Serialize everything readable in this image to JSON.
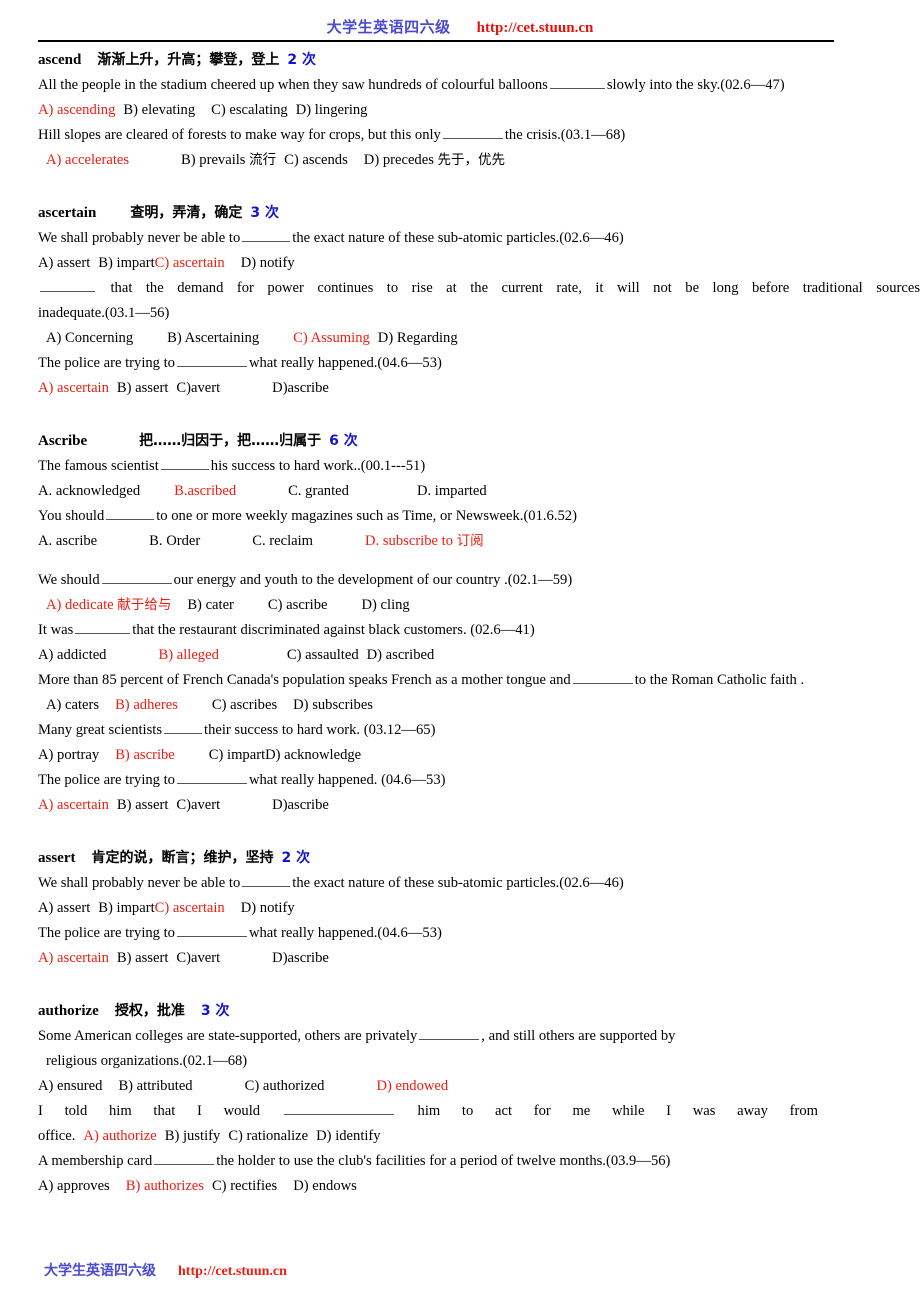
{
  "header": {
    "site_name": "大学生英语四六级",
    "url": "http://cet.stuun.cn"
  },
  "footer": {
    "site_name": "大学生英语四六级",
    "url": "http://cet.stuun.cn"
  },
  "entries": [
    {
      "term": "ascend",
      "gloss": "渐渐上升，升高；攀登，登上",
      "count": "2 次",
      "questions": [
        {
          "stem_before": "All the people in the stadium cheered up when they saw hundreds of colourful balloons",
          "stem_after": "slowly into the sky.(02.6—47)",
          "options": [
            {
              "label": "A) ascending",
              "answer": true
            },
            {
              "label": "B) elevating",
              "answer": false
            },
            {
              "label": "C) escalating",
              "answer": false
            },
            {
              "label": "D) lingering",
              "answer": false
            }
          ]
        },
        {
          "stem_before": "Hill slopes are cleared of forests to make way for crops, but this only",
          "stem_after": "the crisis.(03.1—68)",
          "options": [
            {
              "label": "A) accelerates",
              "answer": true
            },
            {
              "label": "B) prevails",
              "note": "流行",
              "answer": false
            },
            {
              "label": "C) ascends",
              "answer": false
            },
            {
              "label": "D) precedes",
              "note": "先于，优先",
              "answer": false
            }
          ]
        }
      ]
    },
    {
      "term": "ascertain",
      "gloss": "查明，弄清，确定",
      "count": "3 次",
      "questions": [
        {
          "stem_before": "We shall probably never be able to",
          "stem_after": "the exact nature of these sub-atomic particles.(02.6—46)",
          "options": [
            {
              "label": "A) assert",
              "answer": false
            },
            {
              "label": "B) impart",
              "answer": false
            },
            {
              "label": "C) ascertain",
              "answer": true
            },
            {
              "label": "D) notify",
              "answer": false
            }
          ]
        },
        {
          "stem_before": "",
          "stem_justified": "that the demand for power continues to rise at the current rate, it will not be long before traditional sources",
          "stem_after": "inadequate.(03.1—56)",
          "options": [
            {
              "label": "A) Concerning",
              "answer": false
            },
            {
              "label": "B) Ascertaining",
              "answer": false
            },
            {
              "label": "C) Assuming",
              "answer": true
            },
            {
              "label": "D) Regarding",
              "answer": false
            }
          ]
        },
        {
          "stem_before": "The police are trying to",
          "stem_after": "what really happened.(04.6—53)",
          "options": [
            {
              "label": "A) ascertain",
              "answer": true
            },
            {
              "label": "B) assert",
              "answer": false
            },
            {
              "label": "C)avert",
              "answer": false
            },
            {
              "label": "D)ascribe",
              "answer": false
            }
          ]
        }
      ]
    },
    {
      "term": "Ascribe",
      "gloss": "把……归因于，把……归属于",
      "count": "6 次",
      "questions": [
        {
          "stem_before": "The famous scientist",
          "stem_after": "his success to hard work..(00.1---51)",
          "options": [
            {
              "label": "A. acknowledged",
              "answer": false
            },
            {
              "label": "B.ascribed",
              "answer": true
            },
            {
              "label": "C. granted",
              "answer": false
            },
            {
              "label": "D. imparted",
              "answer": false
            }
          ]
        },
        {
          "stem_before": "You should",
          "stem_after": "to one or more weekly magazines such as Time, or Newsweek.(01.6.52)",
          "options": [
            {
              "label": "A. ascribe",
              "answer": false
            },
            {
              "label": "B. Order",
              "answer": false
            },
            {
              "label": "C.   reclaim",
              "answer": false
            },
            {
              "label": "D. subscribe to",
              "note": "订阅",
              "answer": true
            }
          ]
        },
        {
          "stem_before": "We should",
          "stem_after": "our energy and youth to the development of our country .(02.1—59)",
          "options": [
            {
              "label": "A) dedicate",
              "note": "献于给与",
              "answer": true
            },
            {
              "label": "B) cater",
              "answer": false
            },
            {
              "label": "C) ascribe",
              "answer": false
            },
            {
              "label": "D) cling",
              "answer": false
            }
          ]
        },
        {
          "stem_before": "It was",
          "stem_after": "that the restaurant discriminated against black customers. (02.6—41)",
          "options": [
            {
              "label": "A) addicted",
              "answer": false
            },
            {
              "label": "B) alleged",
              "answer": true
            },
            {
              "label": "C) assaulted",
              "answer": false
            },
            {
              "label": "D) ascribed",
              "answer": false
            }
          ]
        },
        {
          "stem_before": "More than 85 percent of French Canada's population speaks French as a mother tongue and",
          "stem_after": "to the Roman Catholic faith .",
          "options": [
            {
              "label": "A) caters",
              "answer": false
            },
            {
              "label": "B) adheres",
              "answer": true
            },
            {
              "label": "C) ascribes",
              "answer": false
            },
            {
              "label": "D) subscribes",
              "answer": false
            }
          ]
        },
        {
          "stem_before": "Many great scientists",
          "stem_after": "their success to hard work. (03.12—65)",
          "options": [
            {
              "label": "A) portray",
              "answer": false
            },
            {
              "label": "B) ascribe",
              "answer": true
            },
            {
              "label": "C) impart",
              "answer": false
            },
            {
              "label": "D) acknowledge",
              "answer": false
            }
          ]
        },
        {
          "stem_before": "The police are trying to",
          "stem_after": "what really happened. (04.6—53)",
          "options": [
            {
              "label": "A) ascertain",
              "answer": true
            },
            {
              "label": "B) assert",
              "answer": false
            },
            {
              "label": "C)avert",
              "answer": false
            },
            {
              "label": "D)ascribe",
              "answer": false
            }
          ]
        }
      ]
    },
    {
      "term": "assert",
      "gloss": "肯定的说，断言；维护，坚持",
      "count": "2 次",
      "questions": [
        {
          "stem_before": "We shall probably never be able to",
          "stem_after": "the exact nature of these sub-atomic particles.(02.6—46)",
          "options": [
            {
              "label": "A) assert",
              "answer": false
            },
            {
              "label": "B) impart",
              "answer": false
            },
            {
              "label": "C) ascertain",
              "answer": true
            },
            {
              "label": "D) notify",
              "answer": false
            }
          ]
        },
        {
          "stem_before": "The police are trying to",
          "stem_after": "what really happened.(04.6—53)",
          "options": [
            {
              "label": "A) ascertain",
              "answer": true
            },
            {
              "label": "B) assert",
              "answer": false
            },
            {
              "label": "C)avert",
              "answer": false
            },
            {
              "label": "D)ascribe",
              "answer": false
            }
          ]
        }
      ]
    },
    {
      "term": "authorize",
      "gloss": "授权，批准",
      "count": "3 次",
      "questions": [
        {
          "stem_before": "Some American colleges are state-supported, others are privately",
          "stem_mid": ", and still others are supported by",
          "stem_after": "religious organizations.(02.1—68)",
          "options": [
            {
              "label": "A) ensured",
              "answer": false
            },
            {
              "label": "B) attributed",
              "answer": false
            },
            {
              "label": "C) authorized",
              "answer": false
            },
            {
              "label": "D) endowed",
              "answer": true
            }
          ]
        },
        {
          "stem_justified": "I told him that I would",
          "stem_after": "him to act for me while I was away from",
          "stem_tail": "office.",
          "options": [
            {
              "label": "A)   authorize",
              "answer": true
            },
            {
              "label": "B)   justify",
              "answer": false
            },
            {
              "label": "C)   rationalize",
              "answer": false
            },
            {
              "label": "D)   identify",
              "answer": false
            }
          ]
        },
        {
          "stem_before": "A membership card",
          "stem_after": "the holder to use the club's facilities for a period of twelve months.(03.9—56)",
          "options": [
            {
              "label": "A) approves",
              "answer": false
            },
            {
              "label": "B) authorizes",
              "answer": true
            },
            {
              "label": "C) rectifies",
              "answer": false
            },
            {
              "label": "D) endows",
              "answer": false
            }
          ]
        }
      ]
    }
  ],
  "colors": {
    "answer_red": "#ef1c10",
    "count_blue": "#1414cf",
    "header_blue": "#4a4ad0",
    "header_red": "#e8120b"
  }
}
